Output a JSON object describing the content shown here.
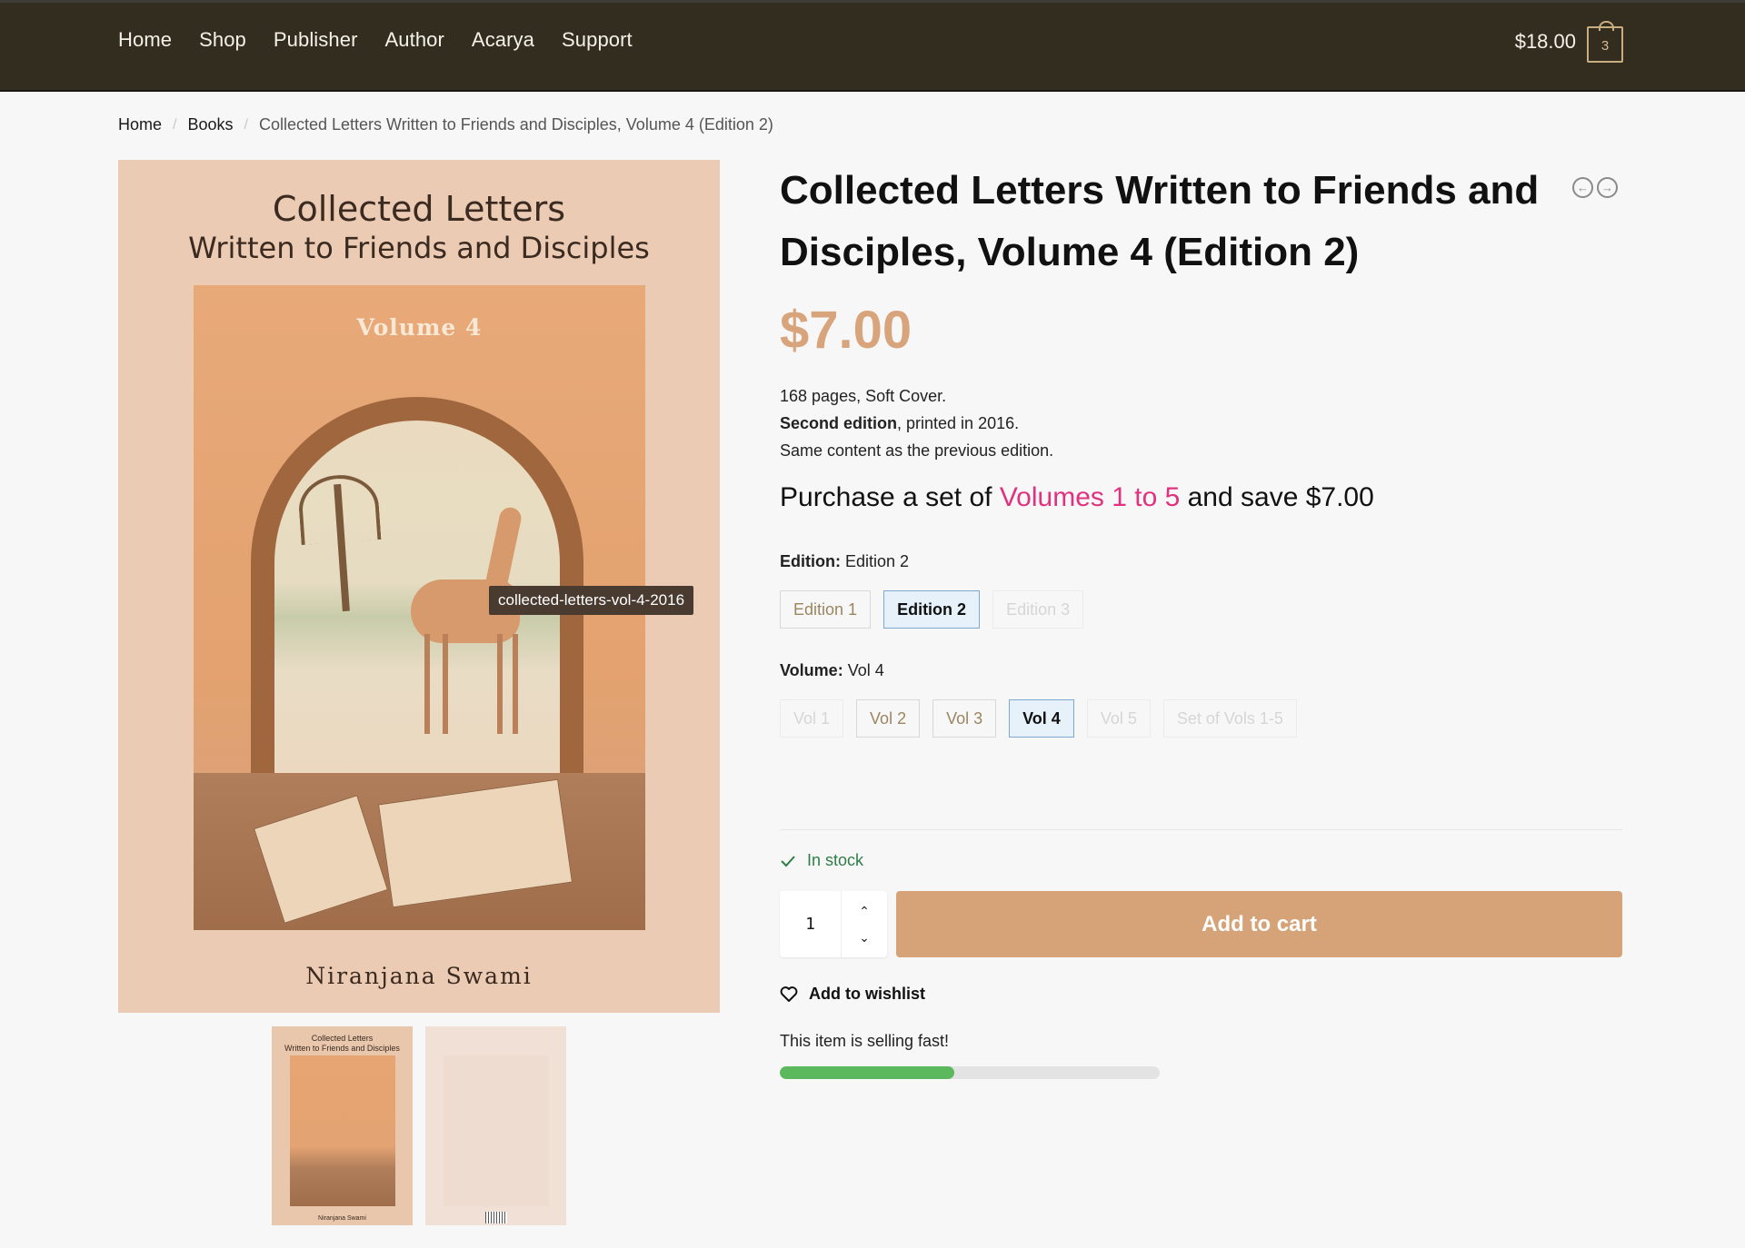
{
  "header": {
    "nav": [
      "Home",
      "Shop",
      "Publisher",
      "Author",
      "Acarya",
      "Support"
    ],
    "cart_total": "$18.00",
    "cart_count": "3"
  },
  "breadcrumb": {
    "items": [
      "Home",
      "Books"
    ],
    "current": "Collected Letters Written to Friends and Disciples, Volume 4 (Edition 2)"
  },
  "gallery": {
    "cover_title_line1": "Collected Letters",
    "cover_title_line2": "Written to Friends and Disciples",
    "cover_volume": "Volume 4",
    "cover_author": "Niranjana Swami",
    "tooltip": "collected-letters-vol-4-2016",
    "next_icon": "chevron-right-icon",
    "thumbnails": [
      {
        "label": "front-cover",
        "title": "Collected Letters\nWritten to Friends and Disciples",
        "author": "Niranjana Swami"
      },
      {
        "label": "back-cover"
      }
    ]
  },
  "product": {
    "title": "Collected Letters Written to Friends and Disciples, Volume 4 (Edition 2)",
    "price": "$7.00",
    "desc_line1": "168 pages, Soft Cover.",
    "desc_line2_bold": "Second edition",
    "desc_line2_rest": ", printed in 2016.",
    "desc_line3": "Same content as the previous edition.",
    "promo_prefix": "Purchase a set of ",
    "promo_link": "Volumes 1 to 5",
    "promo_suffix": " and save $7.00",
    "prev_icon": "arrow-left-circle-icon",
    "next_icon": "arrow-right-circle-icon"
  },
  "edition": {
    "label": "Edition",
    "value": "Edition 2",
    "options": [
      {
        "label": "Edition 1",
        "state": "available"
      },
      {
        "label": "Edition 2",
        "state": "selected"
      },
      {
        "label": "Edition 3",
        "state": "disabled"
      }
    ]
  },
  "volume": {
    "label": "Volume",
    "value": "Vol 4",
    "options": [
      {
        "label": "Vol 1",
        "state": "disabled"
      },
      {
        "label": "Vol 2",
        "state": "available"
      },
      {
        "label": "Vol 3",
        "state": "available"
      },
      {
        "label": "Vol 4",
        "state": "selected"
      },
      {
        "label": "Vol 5",
        "state": "disabled"
      },
      {
        "label": "Set of Vols 1-5",
        "state": "disabled"
      }
    ]
  },
  "purchase": {
    "stock": "In stock",
    "quantity": "1",
    "add_to_cart": "Add to cart",
    "wishlist": "Add to wishlist",
    "selling_fast": "This item is selling fast!",
    "selling_progress_percent": 46
  },
  "colors": {
    "header_bg": "#332d1f",
    "accent": "#d6a378",
    "price": "#d8a47c",
    "link": "#e0327f",
    "stock": "#2e7d47",
    "progress": "#5cb85c"
  }
}
